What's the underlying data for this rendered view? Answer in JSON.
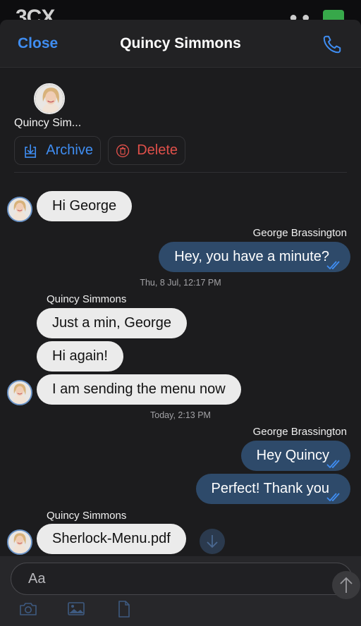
{
  "status_bar": {
    "logo": "3CX"
  },
  "navbar": {
    "close_label": "Close",
    "title": "Quincy Simmons",
    "call_icon": "phone-icon"
  },
  "participant": {
    "name": "Quincy Sim..."
  },
  "actions": {
    "archive_label": "Archive",
    "delete_label": "Delete"
  },
  "messages": {
    "m1": "Hi George",
    "sender_george_1": "George Brassington",
    "m2": "Hey, you have a minute?",
    "stamp1": "Thu, 8 Jul, 12:17 PM",
    "sender_quincy_1": "Quincy Simmons",
    "m3": "Just a min, George",
    "m4": "Hi again!",
    "m5": "I am sending the menu now",
    "stamp2": "Today, 2:13 PM",
    "sender_george_2": "George Brassington",
    "m6": "Hey Quincy",
    "m7": "Perfect! Thank you",
    "sender_quincy_2": "Quincy Simmons",
    "m8": "Sherlock-Menu.pdf"
  },
  "composer": {
    "placeholder": "Aa"
  },
  "colors": {
    "accent": "#3f8df1",
    "danger": "#e0504a",
    "outgoing_bubble": "#2e4a6a",
    "incoming_bubble": "#ebebeb"
  }
}
